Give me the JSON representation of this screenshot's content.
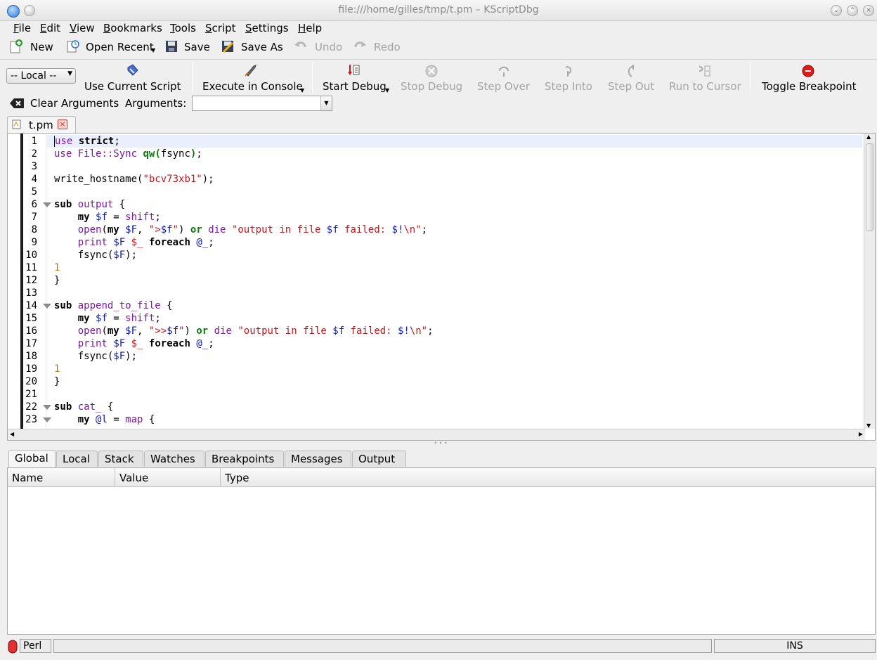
{
  "window": {
    "title": "file:///home/gilles/tmp/t.pm – KScriptDbg"
  },
  "menu": [
    "File",
    "Edit",
    "View",
    "Bookmarks",
    "Tools",
    "Script",
    "Settings",
    "Help"
  ],
  "toolbar_main": {
    "new": "New",
    "open_recent": "Open Recent",
    "save": "Save",
    "save_as": "Save As",
    "undo": "Undo",
    "redo": "Redo"
  },
  "toolbar_debug": {
    "location": "-- Local --",
    "use_current_script": "Use Current Script",
    "execute_in_console": "Execute in Console",
    "start_debug": "Start Debug",
    "stop_debug": "Stop Debug",
    "step_over": "Step Over",
    "step_into": "Step Into",
    "step_out": "Step Out",
    "run_to_cursor": "Run to Cursor",
    "toggle_breakpoint": "Toggle Breakpoint"
  },
  "arguments_bar": {
    "clear": "Clear Arguments",
    "label": "Arguments:",
    "value": ""
  },
  "editor": {
    "tab": "t.pm",
    "line_numbers": [
      "1",
      "2",
      "3",
      "4",
      "5",
      "6",
      "7",
      "8",
      "9",
      "10",
      "11",
      "12",
      "13",
      "14",
      "15",
      "16",
      "17",
      "18",
      "19",
      "20",
      "21",
      "22",
      "23"
    ]
  },
  "bottom_tabs": [
    "Global",
    "Local",
    "Stack",
    "Watches",
    "Breakpoints",
    "Messages",
    "Output"
  ],
  "variables": {
    "columns": [
      "Name",
      "Value",
      "Type"
    ]
  },
  "status": {
    "language": "Perl",
    "mode": "INS"
  }
}
